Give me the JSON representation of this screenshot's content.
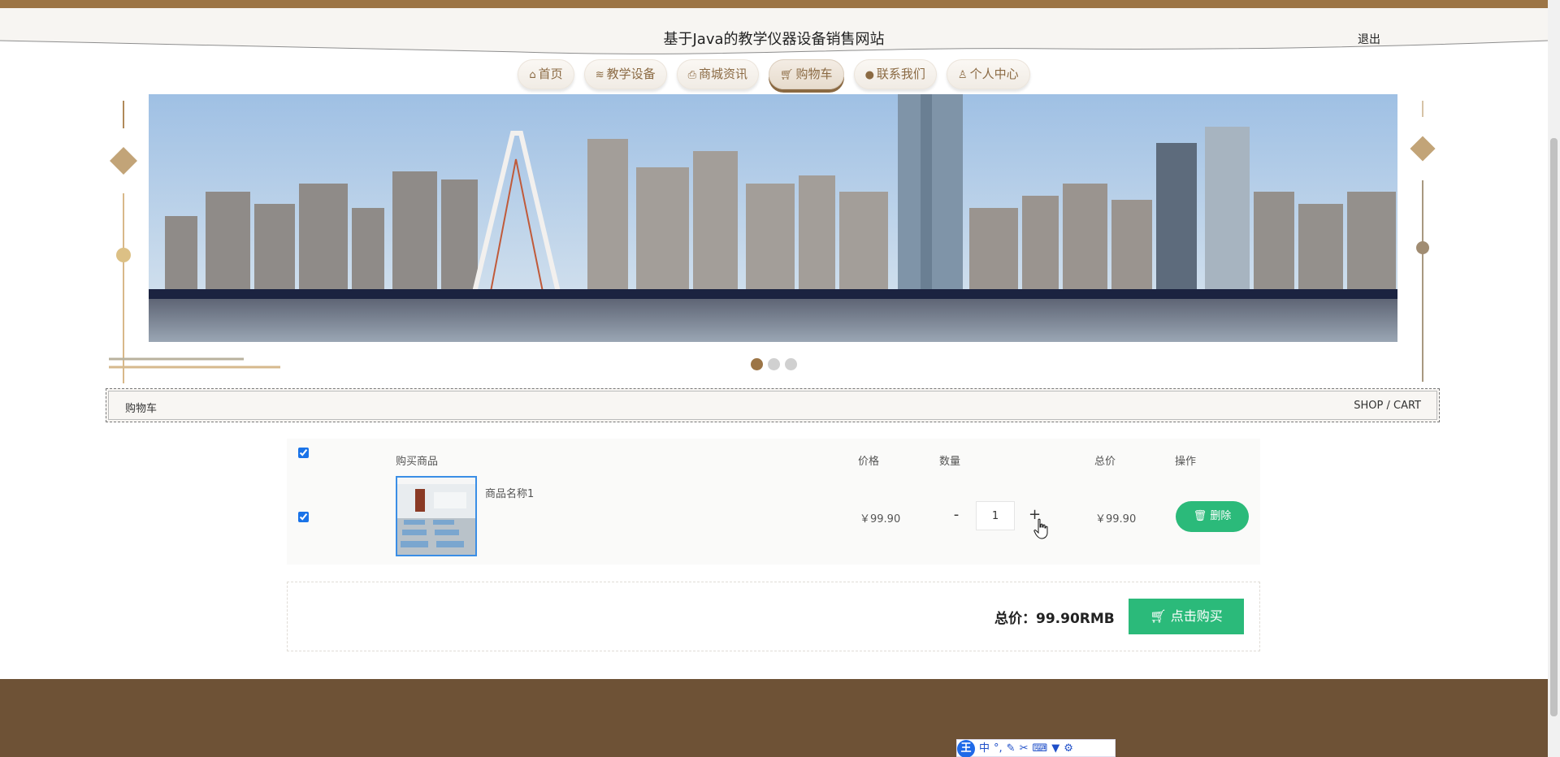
{
  "colors": {
    "accent": "#9c7546",
    "footer": "#6e5236",
    "green": "#2bba7a",
    "text": "#333333"
  },
  "header": {
    "title": "基于Java的教学仪器设备销售网站",
    "logout": "退出"
  },
  "nav": {
    "items": [
      {
        "label": "首页",
        "icon": "home-icon"
      },
      {
        "label": "教学设备",
        "icon": "layers-icon"
      },
      {
        "label": "商城资讯",
        "icon": "printer-icon"
      },
      {
        "label": "购物车",
        "icon": "cart-icon",
        "active": true
      },
      {
        "label": "联系我们",
        "icon": "chat-icon"
      },
      {
        "label": "个人中心",
        "icon": "user-icon"
      }
    ]
  },
  "carousel": {
    "slide_count": 3,
    "active_index": 0
  },
  "breadcrumb": {
    "left": "购物车",
    "right": "SHOP / CART"
  },
  "cart": {
    "headers": {
      "product": "购买商品",
      "price": "价格",
      "qty": "数量",
      "total": "总价",
      "action": "操作"
    },
    "items": [
      {
        "name": "商品名称1",
        "price": "￥99.90",
        "qty": "1",
        "minus": "-",
        "plus": "+",
        "total": "￥99.90",
        "delete_label": "删除",
        "checked": true
      }
    ],
    "select_all_checked": true
  },
  "summary": {
    "total_label": "总价：",
    "total_value": "99.90RMB",
    "buy_label": "点击购买"
  },
  "ime": {
    "logo": "王",
    "mode": "中"
  }
}
